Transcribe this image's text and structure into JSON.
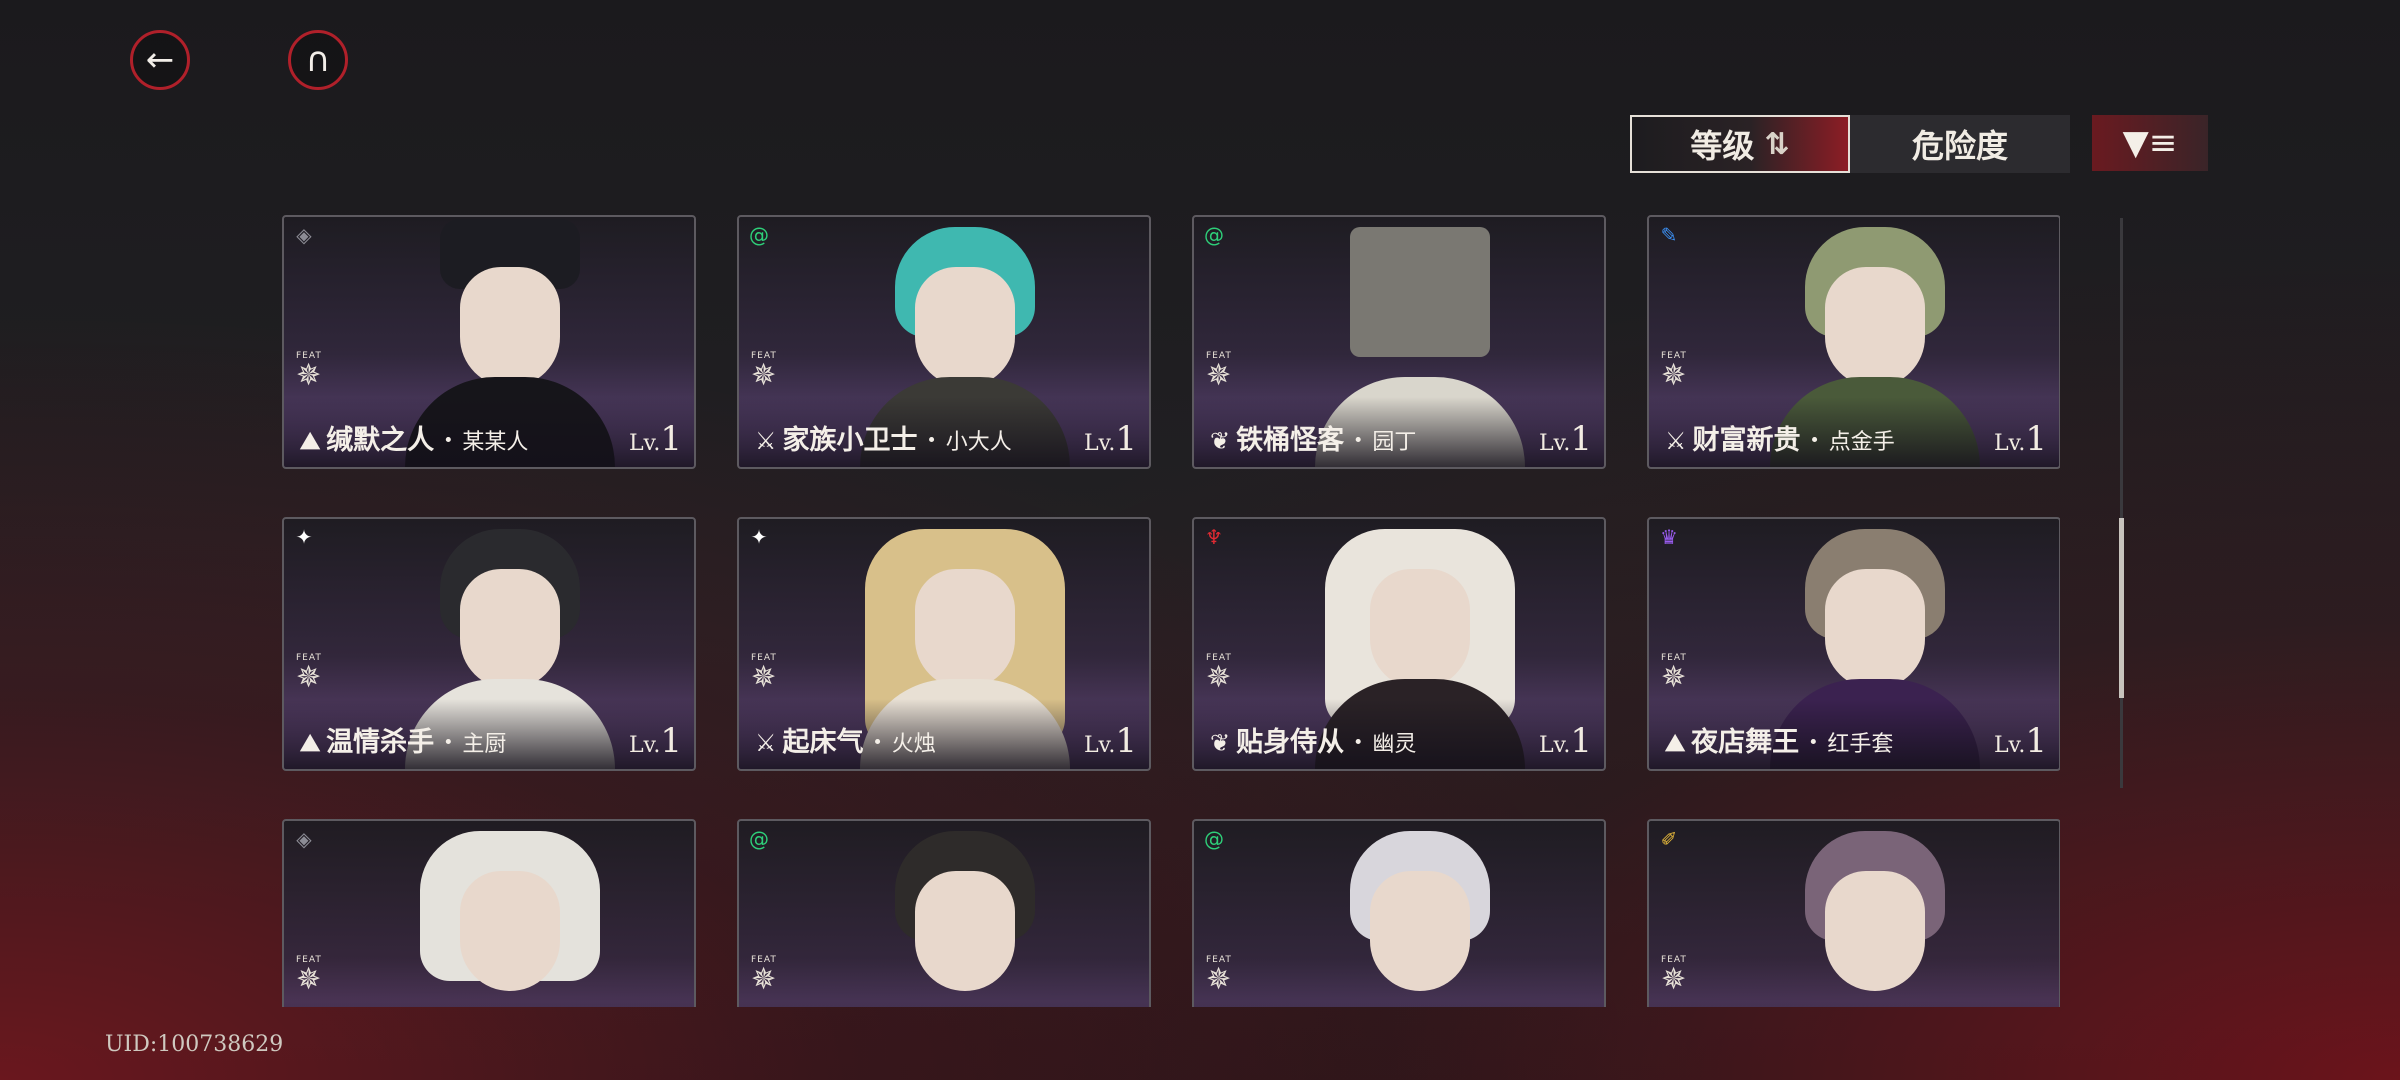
{
  "nav": {
    "back_icon": "back-arrow-icon",
    "home_icon": "home-emblem-icon"
  },
  "sort": {
    "level_label": "等级",
    "danger_label": "危险度",
    "filter_icon": "filter-icon"
  },
  "cards": [
    {
      "title": "缄默之人",
      "sub": "某某人",
      "lv_prefix": "Lv.",
      "lv": "1",
      "feat": "FEAT",
      "icon": "diamond-badge",
      "color": "#8c8c95"
    },
    {
      "title": "家族小卫士",
      "sub": "小大人",
      "lv_prefix": "Lv.",
      "lv": "1",
      "feat": "FEAT",
      "icon": "green-swirl",
      "color": "#2ecf79"
    },
    {
      "title": "铁桶怪客",
      "sub": "园丁",
      "lv_prefix": "Lv.",
      "lv": "1",
      "feat": "FEAT",
      "icon": "green-swirl",
      "color": "#2ecf79"
    },
    {
      "title": "财富新贵",
      "sub": "点金手",
      "lv_prefix": "Lv.",
      "lv": "1",
      "feat": "FEAT",
      "icon": "blue-pin",
      "color": "#3b8ff2"
    },
    {
      "title": "温情杀手",
      "sub": "主厨",
      "lv_prefix": "Lv.",
      "lv": "1",
      "feat": "FEAT",
      "icon": "butterfly",
      "color": "#ffffff"
    },
    {
      "title": "起床气",
      "sub": "火烛",
      "lv_prefix": "Lv.",
      "lv": "1",
      "feat": "FEAT",
      "icon": "butterfly",
      "color": "#ffffff"
    },
    {
      "title": "贴身侍从",
      "sub": "幽灵",
      "lv_prefix": "Lv.",
      "lv": "1",
      "feat": "FEAT",
      "icon": "red-goblet",
      "color": "#e02a33"
    },
    {
      "title": "夜店舞王",
      "sub": "红手套",
      "lv_prefix": "Lv.",
      "lv": "1",
      "feat": "FEAT",
      "icon": "purple-crown",
      "color": "#9a5cf0"
    },
    {
      "title": "",
      "sub": "",
      "lv_prefix": "",
      "lv": "",
      "feat": "FEAT",
      "icon": "diamond-badge",
      "color": "#8c8c95"
    },
    {
      "title": "",
      "sub": "",
      "lv_prefix": "",
      "lv": "",
      "feat": "FEAT",
      "icon": "green-swirl",
      "color": "#2ecf79"
    },
    {
      "title": "",
      "sub": "",
      "lv_prefix": "",
      "lv": "",
      "feat": "FEAT",
      "icon": "green-swirl",
      "color": "#2ecf79"
    },
    {
      "title": "",
      "sub": "",
      "lv_prefix": "",
      "lv": "",
      "feat": "FEAT",
      "icon": "gold-sword",
      "color": "#e0b43a"
    }
  ],
  "uid_label": "UID:100738629"
}
